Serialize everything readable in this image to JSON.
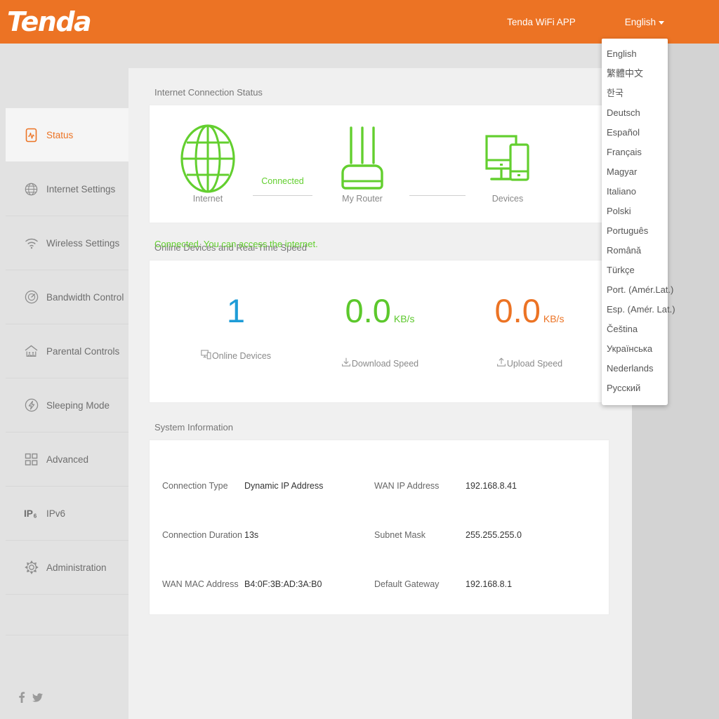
{
  "header": {
    "logo_text": "Tenda",
    "app_link": "Tenda WiFi APP",
    "language_current": "English",
    "brand_color": "#ec7324"
  },
  "language_menu": {
    "items": [
      "English",
      "繁體中文",
      "한국",
      "Deutsch",
      "Español",
      "Français",
      "Magyar",
      "Italiano",
      "Polski",
      "Português",
      "Română",
      "Türkçe",
      "Port. (Amér.Lat.)",
      "Esp. (Amér. Lat.)",
      "Čeština",
      "Українська",
      "Nederlands",
      "Русский"
    ]
  },
  "sidebar": {
    "items": [
      {
        "label": "Status",
        "icon": "status-icon",
        "active": true
      },
      {
        "label": "Internet Settings",
        "icon": "globe-icon",
        "active": false
      },
      {
        "label": "Wireless Settings",
        "icon": "wifi-icon",
        "active": false
      },
      {
        "label": "Bandwidth Control",
        "icon": "gauge-icon",
        "active": false
      },
      {
        "label": "Parental Controls",
        "icon": "house-family-icon",
        "active": false
      },
      {
        "label": "Sleeping Mode",
        "icon": "power-bolt-icon",
        "active": false
      },
      {
        "label": "Advanced",
        "icon": "grid-squares-icon",
        "active": false
      },
      {
        "label": "IPv6",
        "icon": "ipv6-icon",
        "active": false
      },
      {
        "label": "Administration",
        "icon": "gear-icon",
        "active": false
      }
    ],
    "socials": [
      "facebook-icon",
      "twitter-icon"
    ]
  },
  "connection_status": {
    "card_title": "Internet Connection Status",
    "node_internet": "Internet",
    "node_router": "My Router",
    "node_devices": "Devices",
    "link_label": "Connected",
    "message": "Connected. You can access the internet.",
    "status_color": "#63cf2f"
  },
  "speed": {
    "card_title": "Online Devices and Real-Time Speed",
    "metrics": [
      {
        "value": "1",
        "unit": "",
        "label": "Online Devices",
        "color": "#1e9cd7",
        "icon": "devices-icon"
      },
      {
        "value": "0.0",
        "unit": "KB/s",
        "label": "Download Speed",
        "color": "#5cc82c",
        "icon": "download-icon"
      },
      {
        "value": "0.0",
        "unit": "KB/s",
        "label": "Upload Speed",
        "color": "#ec7324",
        "icon": "upload-icon"
      }
    ]
  },
  "system_info": {
    "card_title": "System Information",
    "rows": [
      {
        "k1": "Connection Type",
        "v1": "Dynamic IP Address",
        "k2": "WAN IP Address",
        "v2": "192.168.8.41"
      },
      {
        "k1": "Connection Duration",
        "v1": "13s",
        "k2": "Subnet Mask",
        "v2": "255.255.255.0"
      },
      {
        "k1": "WAN MAC Address",
        "v1": "B4:0F:3B:AD:3A:B0",
        "k2": "Default Gateway",
        "v2": "192.168.8.1"
      }
    ]
  }
}
